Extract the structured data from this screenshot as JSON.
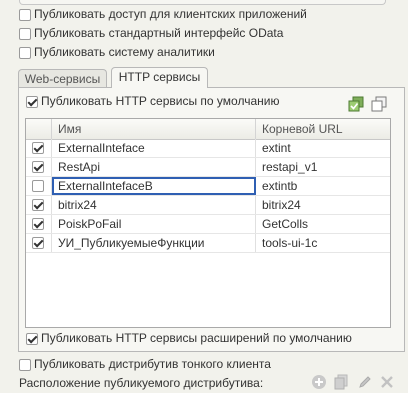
{
  "options": {
    "client_apps": {
      "label": "Публиковать доступ для клиентских приложений",
      "checked": false
    },
    "odata": {
      "label": "Публиковать стандартный интерфейс OData",
      "checked": false
    },
    "analytics": {
      "label": "Публиковать систему аналитики",
      "checked": false
    }
  },
  "tabs": [
    {
      "label": "Web-сервисы",
      "active": false
    },
    {
      "label": "HTTP сервисы",
      "active": true
    }
  ],
  "http": {
    "publish_default": {
      "label": "Публиковать HTTP сервисы по умолчанию",
      "checked": true
    },
    "publish_extensions": {
      "label": "Публиковать HTTP сервисы расширений по умолчанию",
      "checked": true
    },
    "columns": {
      "name": "Имя",
      "url": "Корневой URL"
    },
    "rows": [
      {
        "checked": true,
        "name": "ExternalInteface",
        "url": "extint",
        "selected": false
      },
      {
        "checked": true,
        "name": "RestApi",
        "url": "restapi_v1",
        "selected": false
      },
      {
        "checked": false,
        "name": "ExternalIntefaceB",
        "url": "extintb",
        "selected": true
      },
      {
        "checked": true,
        "name": "bitrix24",
        "url": "bitrix24",
        "selected": false
      },
      {
        "checked": true,
        "name": "PoiskPoFail",
        "url": "GetColls",
        "selected": false
      },
      {
        "checked": true,
        "name": "УИ_ПубликуемыеФункции",
        "url": "tools-ui-1c",
        "selected": false
      }
    ]
  },
  "thin_client": {
    "publish": {
      "label": "Публиковать дистрибутив тонкого клиента",
      "checked": false
    },
    "location_label": "Расположение публикуемого дистрибутива:"
  },
  "icons": {
    "check_all": "check-all-icon",
    "uncheck_all": "uncheck-all-icon",
    "add": "add-icon",
    "copy": "copy-icon",
    "edit": "edit-icon",
    "delete": "delete-icon"
  }
}
